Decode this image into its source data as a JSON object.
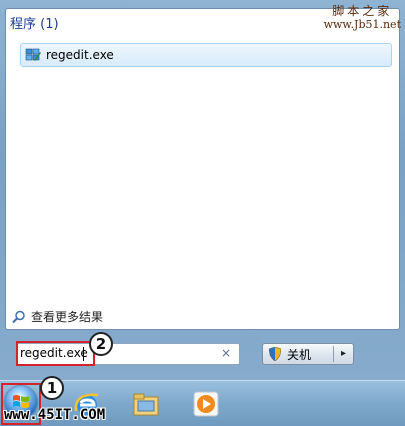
{
  "start_menu": {
    "section_header": "程序 (1)",
    "results": [
      {
        "label": "regedit.exe",
        "icon": "regedit-icon"
      }
    ],
    "see_more": "查看更多结果",
    "search": {
      "value": "regedit.exe",
      "clear_icon": "×"
    },
    "shutdown": {
      "label": "关机",
      "arrow": "▸"
    }
  },
  "callouts": {
    "one": "1",
    "two": "2"
  },
  "watermarks": {
    "top_cn": "脚本之家",
    "top_url": "www.Jb51.net",
    "bottom": "www.45IT.COM"
  },
  "taskbar": {
    "icons": [
      "start-orb-icon",
      "internet-explorer-icon",
      "file-explorer-icon",
      "media-player-icon"
    ]
  },
  "colors": {
    "highlight_red": "#d6222b",
    "header_blue": "#1e3d8f",
    "selection_blue": "#d7ebfb"
  }
}
